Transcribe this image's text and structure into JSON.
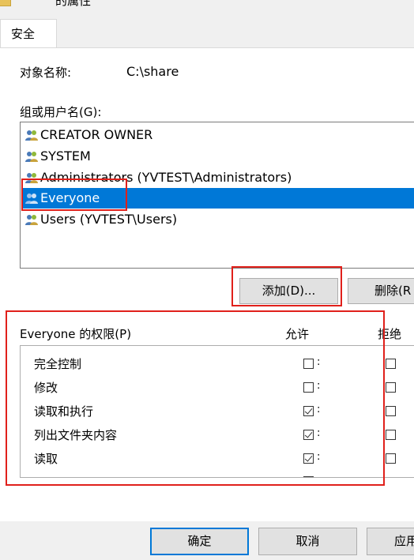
{
  "window": {
    "title_partial": "的属性"
  },
  "tabs": [
    {
      "label": "安全"
    }
  ],
  "object_name": {
    "label": "对象名称:",
    "value": "C:\\share"
  },
  "groups": {
    "label": "组或用户名(G):",
    "items": [
      {
        "label": "CREATOR OWNER",
        "icon": "users-icon"
      },
      {
        "label": "SYSTEM",
        "icon": "users-icon"
      },
      {
        "label": "Administrators (YVTEST\\Administrators)",
        "icon": "users-icon"
      },
      {
        "label": "Everyone",
        "icon": "users-icon",
        "selected": true
      },
      {
        "label": "Users (YVTEST\\Users)",
        "icon": "users-icon"
      }
    ]
  },
  "buttons": {
    "add": "添加(D)...",
    "remove": "删除(R",
    "ok": "确定",
    "cancel": "取消",
    "apply": "应用"
  },
  "permissions": {
    "title": "Everyone 的权限(P)",
    "allow": "允许",
    "deny": "拒绝",
    "items": [
      {
        "label": "完全控制",
        "allow": false,
        "deny": false
      },
      {
        "label": "修改",
        "allow": false,
        "deny": false
      },
      {
        "label": "读取和执行",
        "allow": true,
        "deny": false
      },
      {
        "label": "列出文件夹内容",
        "allow": true,
        "deny": false
      },
      {
        "label": "读取",
        "allow": true,
        "deny": false
      }
    ]
  },
  "colors": {
    "selection": "#0078d7",
    "annotation": "#e0201b"
  }
}
